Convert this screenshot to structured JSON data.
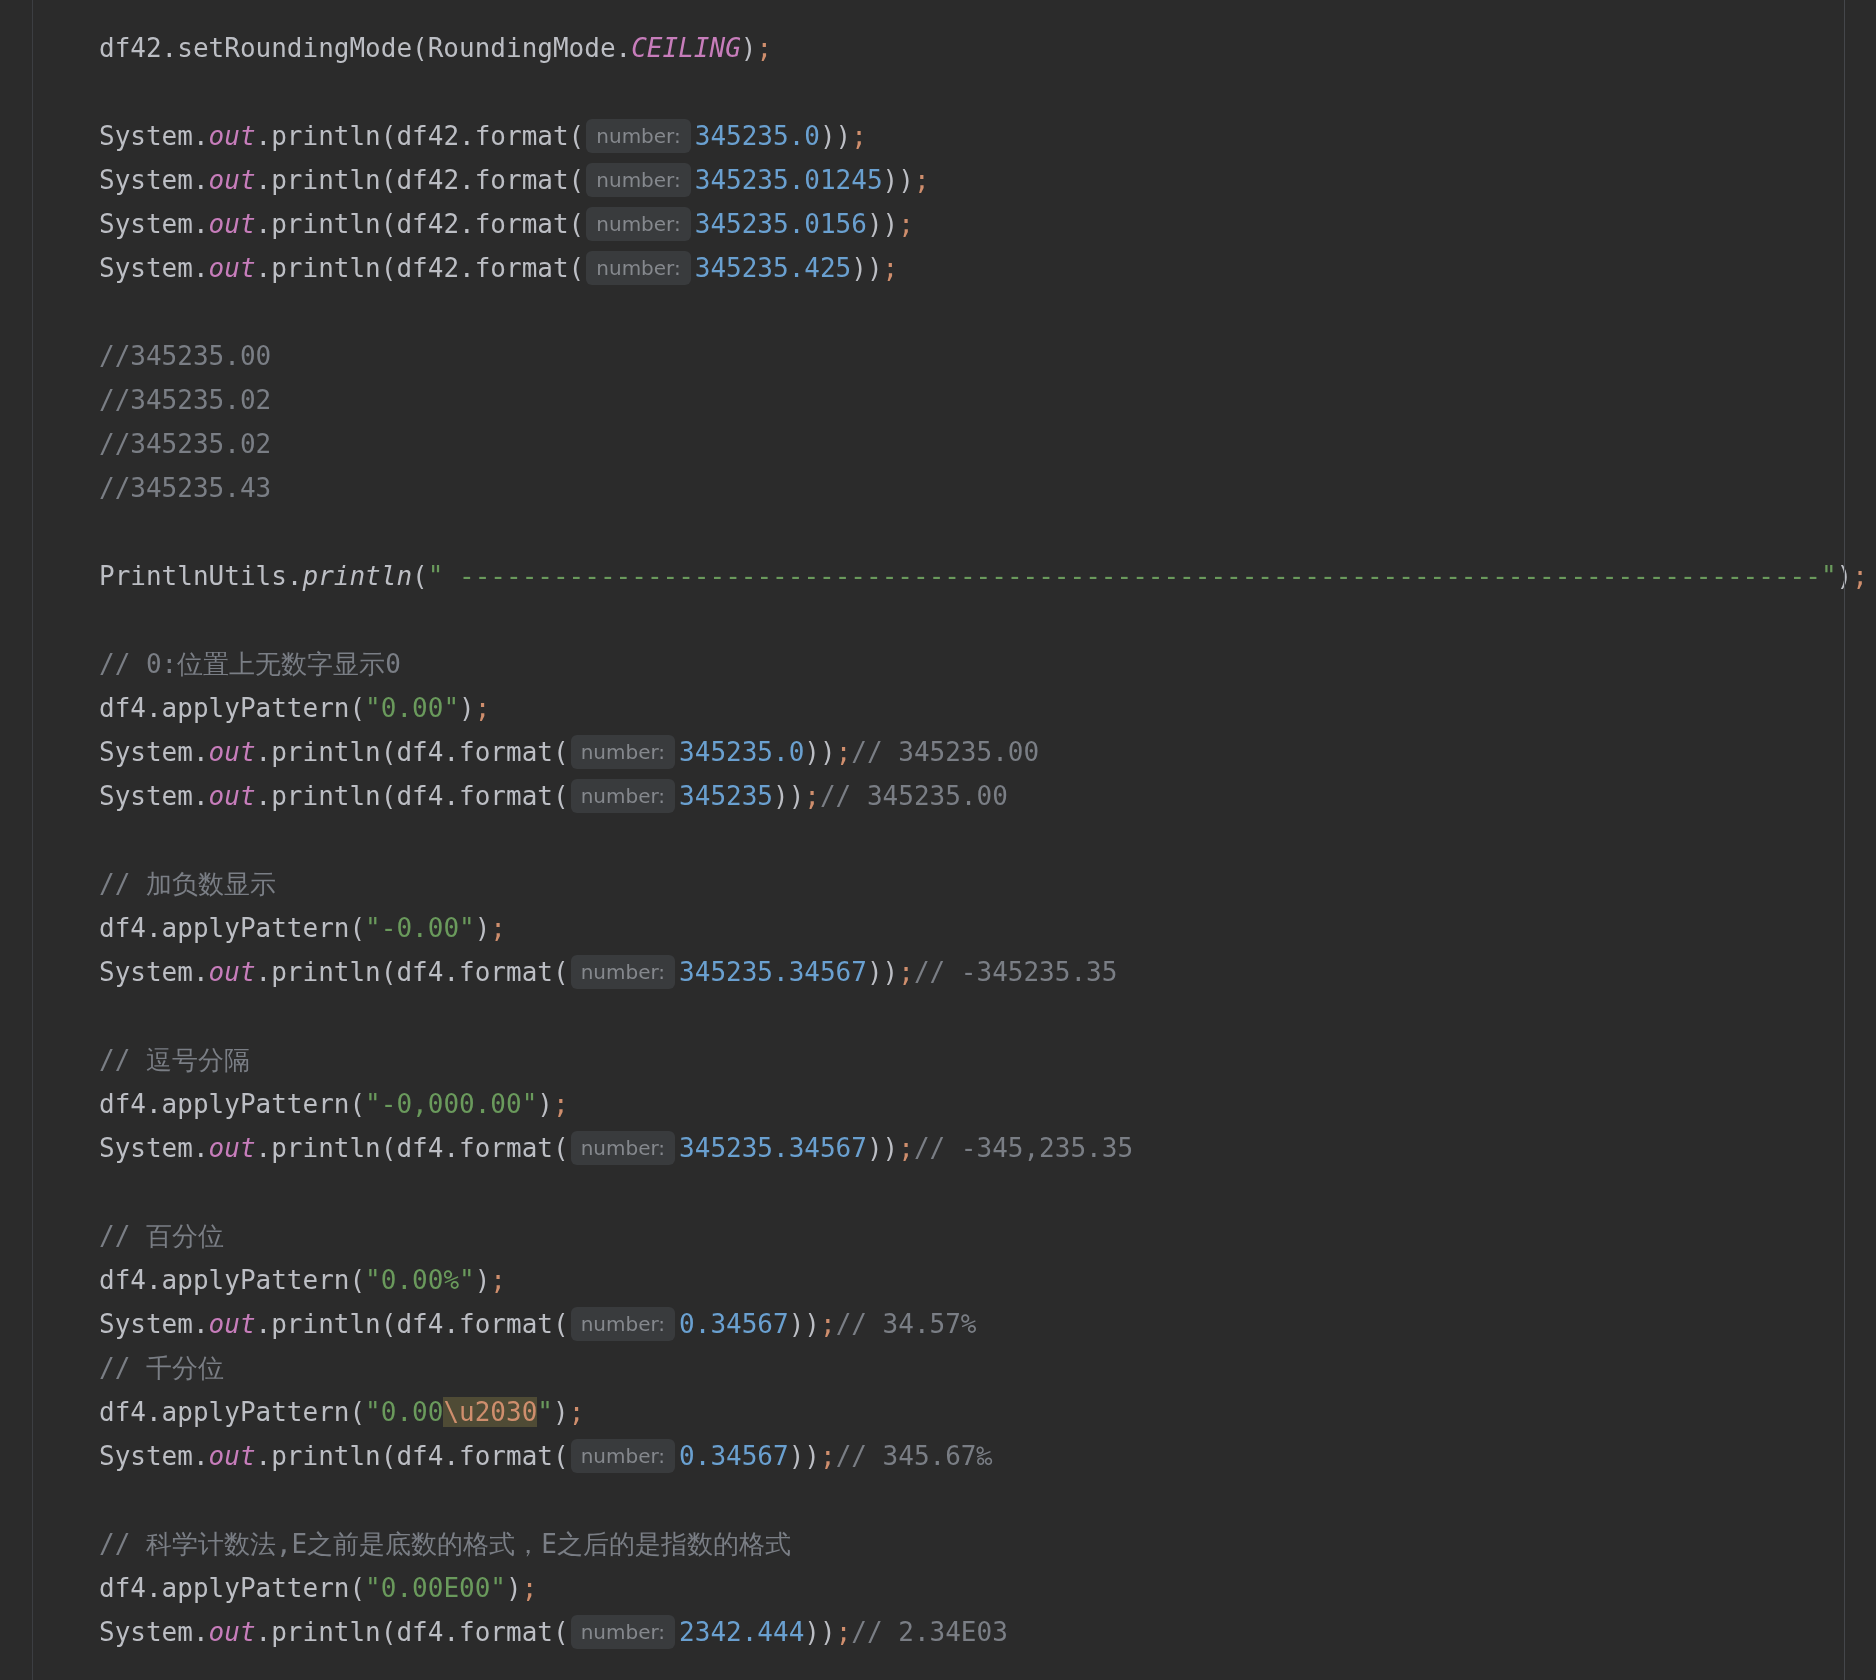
{
  "editor": {
    "blocks": [
      {
        "lines": [
          {
            "tokens": [
              {
                "kind": "plain",
                "text": "df42.setRoundingMode(RoundingMode."
              },
              {
                "kind": "constant",
                "text": "CEILING"
              },
              {
                "kind": "plain",
                "text": ")"
              },
              {
                "kind": "punct",
                "text": ";"
              }
            ]
          }
        ]
      },
      {
        "lines": [
          {
            "tokens": [
              {
                "kind": "plain",
                "text": "System."
              },
              {
                "kind": "field",
                "text": "out"
              },
              {
                "kind": "plain",
                "text": ".println(df42.format("
              },
              {
                "kind": "hint",
                "text": "number:"
              },
              {
                "kind": "number",
                "text": "345235.0"
              },
              {
                "kind": "plain",
                "text": "))"
              },
              {
                "kind": "punct",
                "text": ";"
              }
            ]
          },
          {
            "tokens": [
              {
                "kind": "plain",
                "text": "System."
              },
              {
                "kind": "field",
                "text": "out"
              },
              {
                "kind": "plain",
                "text": ".println(df42.format("
              },
              {
                "kind": "hint",
                "text": "number:"
              },
              {
                "kind": "number",
                "text": "345235.01245"
              },
              {
                "kind": "plain",
                "text": "))"
              },
              {
                "kind": "punct",
                "text": ";"
              }
            ]
          },
          {
            "tokens": [
              {
                "kind": "plain",
                "text": "System."
              },
              {
                "kind": "field",
                "text": "out"
              },
              {
                "kind": "plain",
                "text": ".println(df42.format("
              },
              {
                "kind": "hint",
                "text": "number:"
              },
              {
                "kind": "number",
                "text": "345235.0156"
              },
              {
                "kind": "plain",
                "text": "))"
              },
              {
                "kind": "punct",
                "text": ";"
              }
            ]
          },
          {
            "tokens": [
              {
                "kind": "plain",
                "text": "System."
              },
              {
                "kind": "field",
                "text": "out"
              },
              {
                "kind": "plain",
                "text": ".println(df42.format("
              },
              {
                "kind": "hint",
                "text": "number:"
              },
              {
                "kind": "number",
                "text": "345235.425"
              },
              {
                "kind": "plain",
                "text": "))"
              },
              {
                "kind": "punct",
                "text": ";"
              }
            ]
          }
        ]
      },
      {
        "lines": [
          {
            "tokens": [
              {
                "kind": "comment",
                "text": "//345235.00"
              }
            ]
          },
          {
            "tokens": [
              {
                "kind": "comment",
                "text": "//345235.02"
              }
            ]
          },
          {
            "tokens": [
              {
                "kind": "comment",
                "text": "//345235.02"
              }
            ]
          },
          {
            "tokens": [
              {
                "kind": "comment",
                "text": "//345235.43"
              }
            ]
          }
        ]
      },
      {
        "lines": [
          {
            "tokens": [
              {
                "kind": "plain",
                "text": "PrintlnUtils."
              },
              {
                "kind": "static",
                "text": "println"
              },
              {
                "kind": "plain",
                "text": "("
              },
              {
                "kind": "string",
                "text": "\" ---------------------------------------------------------------------------------------\""
              },
              {
                "kind": "plain",
                "text": ")"
              },
              {
                "kind": "punct",
                "text": ";"
              }
            ]
          }
        ]
      },
      {
        "lines": [
          {
            "tokens": [
              {
                "kind": "comment",
                "text": "// 0:位置上无数字显示0"
              }
            ]
          },
          {
            "tokens": [
              {
                "kind": "plain",
                "text": "df4.applyPattern("
              },
              {
                "kind": "string",
                "text": "\"0.00\""
              },
              {
                "kind": "plain",
                "text": ")"
              },
              {
                "kind": "punct",
                "text": ";"
              }
            ]
          },
          {
            "tokens": [
              {
                "kind": "plain",
                "text": "System."
              },
              {
                "kind": "field",
                "text": "out"
              },
              {
                "kind": "plain",
                "text": ".println(df4.format("
              },
              {
                "kind": "hint",
                "text": "number:"
              },
              {
                "kind": "number",
                "text": "345235.0"
              },
              {
                "kind": "plain",
                "text": "))"
              },
              {
                "kind": "punct",
                "text": ";"
              },
              {
                "kind": "comment",
                "text": "// 345235.00"
              }
            ]
          },
          {
            "tokens": [
              {
                "kind": "plain",
                "text": "System."
              },
              {
                "kind": "field",
                "text": "out"
              },
              {
                "kind": "plain",
                "text": ".println(df4.format("
              },
              {
                "kind": "hint",
                "text": "number:"
              },
              {
                "kind": "number",
                "text": "345235"
              },
              {
                "kind": "plain",
                "text": "))"
              },
              {
                "kind": "punct",
                "text": ";"
              },
              {
                "kind": "comment",
                "text": "// 345235.00"
              }
            ]
          }
        ]
      },
      {
        "lines": [
          {
            "tokens": [
              {
                "kind": "comment",
                "text": "// 加负数显示"
              }
            ]
          },
          {
            "tokens": [
              {
                "kind": "plain",
                "text": "df4.applyPattern("
              },
              {
                "kind": "string",
                "text": "\"-0.00\""
              },
              {
                "kind": "plain",
                "text": ")"
              },
              {
                "kind": "punct",
                "text": ";"
              }
            ]
          },
          {
            "tokens": [
              {
                "kind": "plain",
                "text": "System."
              },
              {
                "kind": "field",
                "text": "out"
              },
              {
                "kind": "plain",
                "text": ".println(df4.format("
              },
              {
                "kind": "hint",
                "text": "number:"
              },
              {
                "kind": "number",
                "text": "345235.34567"
              },
              {
                "kind": "plain",
                "text": "))"
              },
              {
                "kind": "punct",
                "text": ";"
              },
              {
                "kind": "comment",
                "text": "// -345235.35"
              }
            ]
          }
        ]
      },
      {
        "lines": [
          {
            "tokens": [
              {
                "kind": "comment",
                "text": "// 逗号分隔"
              }
            ]
          },
          {
            "tokens": [
              {
                "kind": "plain",
                "text": "df4.applyPattern("
              },
              {
                "kind": "string",
                "text": "\"-0,000.00\""
              },
              {
                "kind": "plain",
                "text": ")"
              },
              {
                "kind": "punct",
                "text": ";"
              }
            ]
          },
          {
            "tokens": [
              {
                "kind": "plain",
                "text": "System."
              },
              {
                "kind": "field",
                "text": "out"
              },
              {
                "kind": "plain",
                "text": ".println(df4.format("
              },
              {
                "kind": "hint",
                "text": "number:"
              },
              {
                "kind": "number",
                "text": "345235.34567"
              },
              {
                "kind": "plain",
                "text": "))"
              },
              {
                "kind": "punct",
                "text": ";"
              },
              {
                "kind": "comment",
                "text": "// -345,235.35"
              }
            ]
          }
        ]
      },
      {
        "lines": [
          {
            "tokens": [
              {
                "kind": "comment",
                "text": "// 百分位"
              }
            ]
          },
          {
            "tokens": [
              {
                "kind": "plain",
                "text": "df4.applyPattern("
              },
              {
                "kind": "string",
                "text": "\"0.00%\""
              },
              {
                "kind": "plain",
                "text": ")"
              },
              {
                "kind": "punct",
                "text": ";"
              }
            ]
          },
          {
            "tokens": [
              {
                "kind": "plain",
                "text": "System."
              },
              {
                "kind": "field",
                "text": "out"
              },
              {
                "kind": "plain",
                "text": ".println(df4.format("
              },
              {
                "kind": "hint",
                "text": "number:"
              },
              {
                "kind": "number",
                "text": "0.34567"
              },
              {
                "kind": "plain",
                "text": "))"
              },
              {
                "kind": "punct",
                "text": ";"
              },
              {
                "kind": "comment",
                "text": "// 34.57%"
              }
            ]
          },
          {
            "tokens": [
              {
                "kind": "comment",
                "text": "// 千分位"
              }
            ]
          },
          {
            "tokens": [
              {
                "kind": "plain",
                "text": "df4.applyPattern("
              },
              {
                "kind": "string",
                "text": "\"0.00"
              },
              {
                "kind": "escape",
                "text": "\\u2030"
              },
              {
                "kind": "string",
                "text": "\""
              },
              {
                "kind": "plain",
                "text": ")"
              },
              {
                "kind": "punct",
                "text": ";"
              }
            ]
          },
          {
            "tokens": [
              {
                "kind": "plain",
                "text": "System."
              },
              {
                "kind": "field",
                "text": "out"
              },
              {
                "kind": "plain",
                "text": ".println(df4.format("
              },
              {
                "kind": "hint",
                "text": "number:"
              },
              {
                "kind": "number",
                "text": "0.34567"
              },
              {
                "kind": "plain",
                "text": "))"
              },
              {
                "kind": "punct",
                "text": ";"
              },
              {
                "kind": "comment",
                "text": "// 345.67‰"
              }
            ]
          }
        ]
      },
      {
        "lines": [
          {
            "tokens": [
              {
                "kind": "comment",
                "text": "// 科学计数法,E之前是底数的格式，E之后的是指数的格式"
              }
            ]
          },
          {
            "tokens": [
              {
                "kind": "plain",
                "text": "df4.applyPattern("
              },
              {
                "kind": "string",
                "text": "\"0.00E00\""
              },
              {
                "kind": "plain",
                "text": ")"
              },
              {
                "kind": "punct",
                "text": ";"
              }
            ]
          },
          {
            "tokens": [
              {
                "kind": "plain",
                "text": "System."
              },
              {
                "kind": "field",
                "text": "out"
              },
              {
                "kind": "plain",
                "text": ".println(df4.format("
              },
              {
                "kind": "hint",
                "text": "number:"
              },
              {
                "kind": "number",
                "text": "2342.444"
              },
              {
                "kind": "plain",
                "text": "))"
              },
              {
                "kind": "punct",
                "text": ";"
              },
              {
                "kind": "comment",
                "text": "// 2.34E03"
              }
            ]
          }
        ]
      }
    ]
  }
}
